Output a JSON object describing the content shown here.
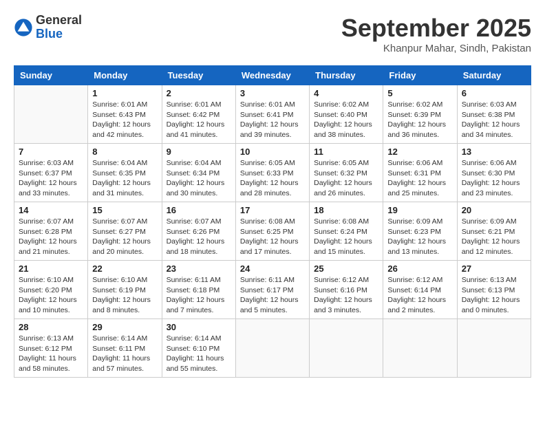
{
  "header": {
    "logo_general": "General",
    "logo_blue": "Blue",
    "month_title": "September 2025",
    "location": "Khanpur Mahar, Sindh, Pakistan"
  },
  "days_of_week": [
    "Sunday",
    "Monday",
    "Tuesday",
    "Wednesday",
    "Thursday",
    "Friday",
    "Saturday"
  ],
  "weeks": [
    [
      {
        "day": "",
        "info": ""
      },
      {
        "day": "1",
        "info": "Sunrise: 6:01 AM\nSunset: 6:43 PM\nDaylight: 12 hours\nand 42 minutes."
      },
      {
        "day": "2",
        "info": "Sunrise: 6:01 AM\nSunset: 6:42 PM\nDaylight: 12 hours\nand 41 minutes."
      },
      {
        "day": "3",
        "info": "Sunrise: 6:01 AM\nSunset: 6:41 PM\nDaylight: 12 hours\nand 39 minutes."
      },
      {
        "day": "4",
        "info": "Sunrise: 6:02 AM\nSunset: 6:40 PM\nDaylight: 12 hours\nand 38 minutes."
      },
      {
        "day": "5",
        "info": "Sunrise: 6:02 AM\nSunset: 6:39 PM\nDaylight: 12 hours\nand 36 minutes."
      },
      {
        "day": "6",
        "info": "Sunrise: 6:03 AM\nSunset: 6:38 PM\nDaylight: 12 hours\nand 34 minutes."
      }
    ],
    [
      {
        "day": "7",
        "info": "Sunrise: 6:03 AM\nSunset: 6:37 PM\nDaylight: 12 hours\nand 33 minutes."
      },
      {
        "day": "8",
        "info": "Sunrise: 6:04 AM\nSunset: 6:35 PM\nDaylight: 12 hours\nand 31 minutes."
      },
      {
        "day": "9",
        "info": "Sunrise: 6:04 AM\nSunset: 6:34 PM\nDaylight: 12 hours\nand 30 minutes."
      },
      {
        "day": "10",
        "info": "Sunrise: 6:05 AM\nSunset: 6:33 PM\nDaylight: 12 hours\nand 28 minutes."
      },
      {
        "day": "11",
        "info": "Sunrise: 6:05 AM\nSunset: 6:32 PM\nDaylight: 12 hours\nand 26 minutes."
      },
      {
        "day": "12",
        "info": "Sunrise: 6:06 AM\nSunset: 6:31 PM\nDaylight: 12 hours\nand 25 minutes."
      },
      {
        "day": "13",
        "info": "Sunrise: 6:06 AM\nSunset: 6:30 PM\nDaylight: 12 hours\nand 23 minutes."
      }
    ],
    [
      {
        "day": "14",
        "info": "Sunrise: 6:07 AM\nSunset: 6:28 PM\nDaylight: 12 hours\nand 21 minutes."
      },
      {
        "day": "15",
        "info": "Sunrise: 6:07 AM\nSunset: 6:27 PM\nDaylight: 12 hours\nand 20 minutes."
      },
      {
        "day": "16",
        "info": "Sunrise: 6:07 AM\nSunset: 6:26 PM\nDaylight: 12 hours\nand 18 minutes."
      },
      {
        "day": "17",
        "info": "Sunrise: 6:08 AM\nSunset: 6:25 PM\nDaylight: 12 hours\nand 17 minutes."
      },
      {
        "day": "18",
        "info": "Sunrise: 6:08 AM\nSunset: 6:24 PM\nDaylight: 12 hours\nand 15 minutes."
      },
      {
        "day": "19",
        "info": "Sunrise: 6:09 AM\nSunset: 6:23 PM\nDaylight: 12 hours\nand 13 minutes."
      },
      {
        "day": "20",
        "info": "Sunrise: 6:09 AM\nSunset: 6:21 PM\nDaylight: 12 hours\nand 12 minutes."
      }
    ],
    [
      {
        "day": "21",
        "info": "Sunrise: 6:10 AM\nSunset: 6:20 PM\nDaylight: 12 hours\nand 10 minutes."
      },
      {
        "day": "22",
        "info": "Sunrise: 6:10 AM\nSunset: 6:19 PM\nDaylight: 12 hours\nand 8 minutes."
      },
      {
        "day": "23",
        "info": "Sunrise: 6:11 AM\nSunset: 6:18 PM\nDaylight: 12 hours\nand 7 minutes."
      },
      {
        "day": "24",
        "info": "Sunrise: 6:11 AM\nSunset: 6:17 PM\nDaylight: 12 hours\nand 5 minutes."
      },
      {
        "day": "25",
        "info": "Sunrise: 6:12 AM\nSunset: 6:16 PM\nDaylight: 12 hours\nand 3 minutes."
      },
      {
        "day": "26",
        "info": "Sunrise: 6:12 AM\nSunset: 6:14 PM\nDaylight: 12 hours\nand 2 minutes."
      },
      {
        "day": "27",
        "info": "Sunrise: 6:13 AM\nSunset: 6:13 PM\nDaylight: 12 hours\nand 0 minutes."
      }
    ],
    [
      {
        "day": "28",
        "info": "Sunrise: 6:13 AM\nSunset: 6:12 PM\nDaylight: 11 hours\nand 58 minutes."
      },
      {
        "day": "29",
        "info": "Sunrise: 6:14 AM\nSunset: 6:11 PM\nDaylight: 11 hours\nand 57 minutes."
      },
      {
        "day": "30",
        "info": "Sunrise: 6:14 AM\nSunset: 6:10 PM\nDaylight: 11 hours\nand 55 minutes."
      },
      {
        "day": "",
        "info": ""
      },
      {
        "day": "",
        "info": ""
      },
      {
        "day": "",
        "info": ""
      },
      {
        "day": "",
        "info": ""
      }
    ]
  ]
}
